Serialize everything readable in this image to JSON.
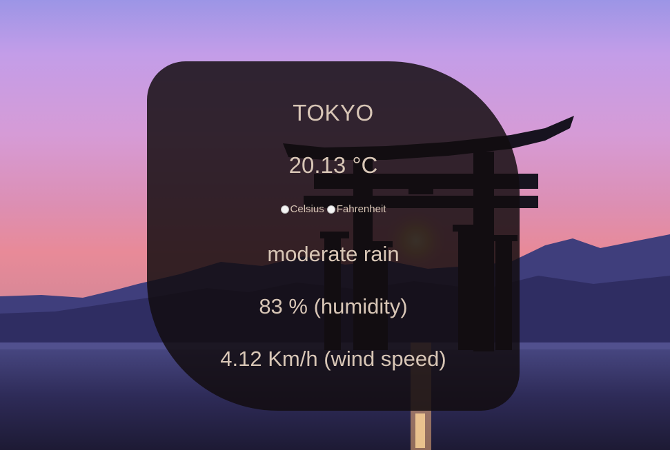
{
  "weather": {
    "city": "TOKYO",
    "temperature": "20.13 °C",
    "units": {
      "celsius_label": "Celsius",
      "fahrenheit_label": "Fahrenheit"
    },
    "description": "moderate rain",
    "humidity": "83 % (humidity)",
    "wind": "4.12 Km/h (wind speed)"
  },
  "background": {
    "image": "torii-gate-sunset-icon"
  }
}
